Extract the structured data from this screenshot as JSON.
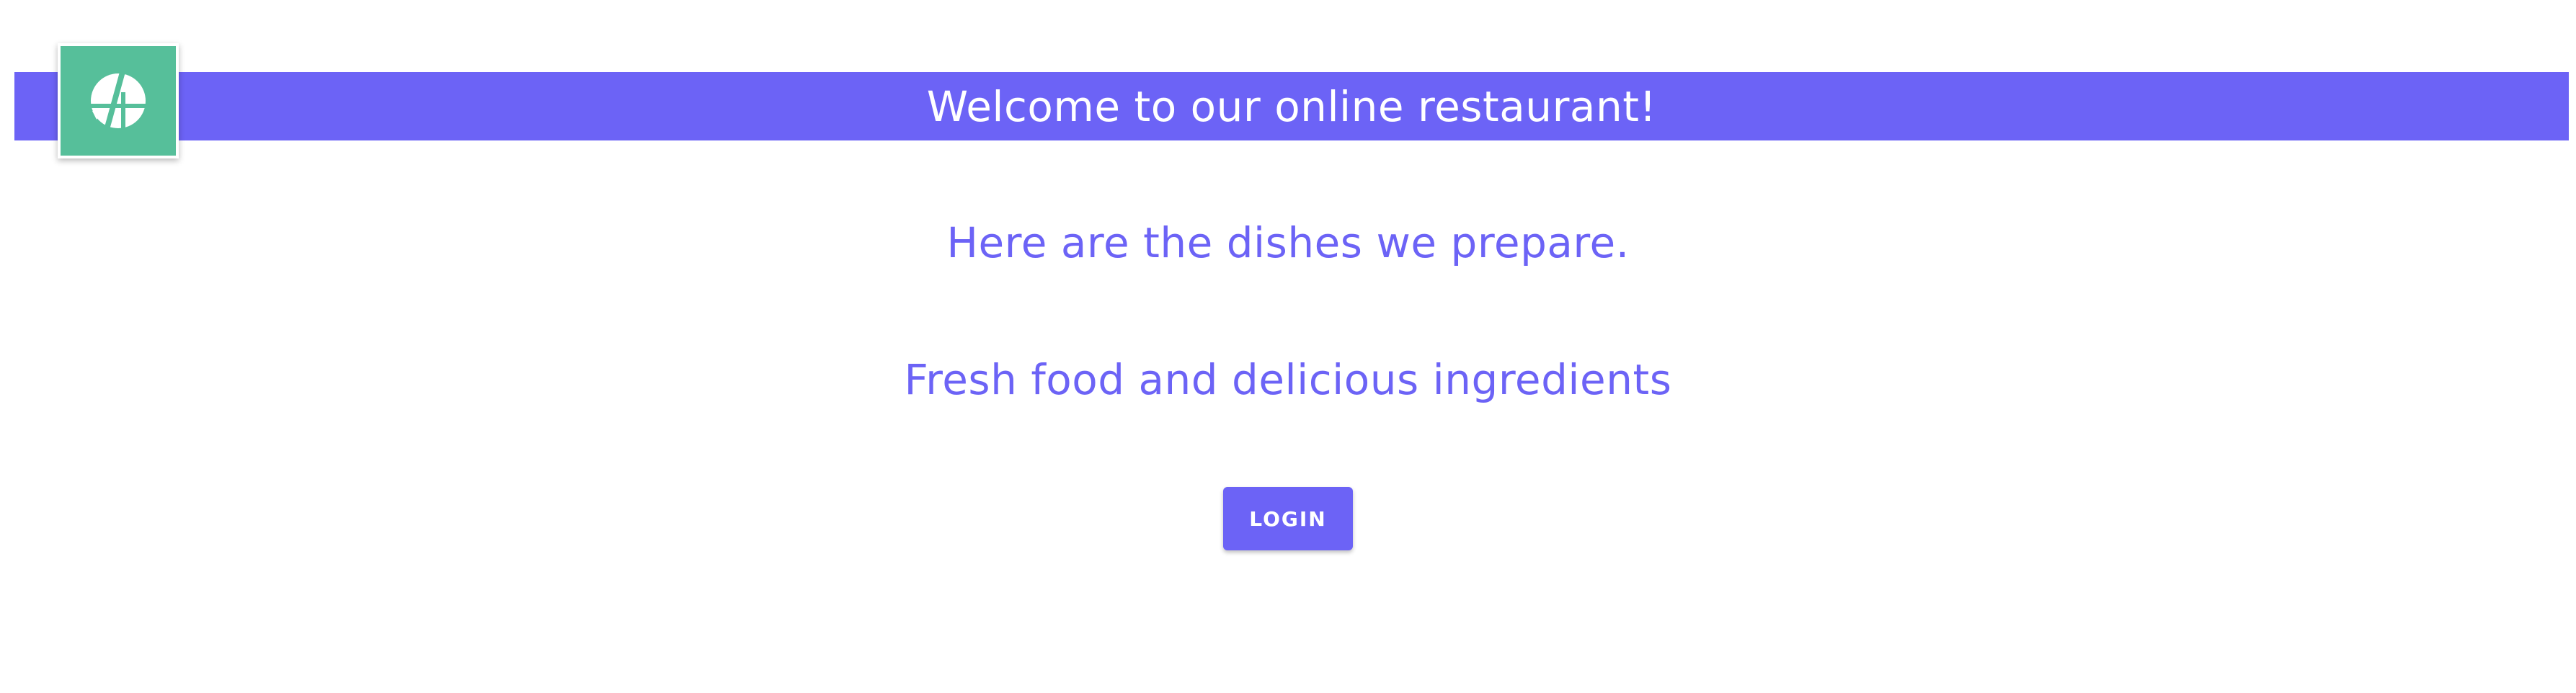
{
  "header": {
    "title": "Welcome to our online restaurant!",
    "logo_icon": "app-logo-icon"
  },
  "main": {
    "subtitle": "Here are the dishes we prepare.",
    "tagline": "Fresh food and delicious ingredients",
    "login_label": "LOGIN"
  },
  "colors": {
    "primary": "#6c63f6",
    "logo_bg": "#56bf9a",
    "background": "#ffffff",
    "text_on_primary": "#ffffff"
  }
}
